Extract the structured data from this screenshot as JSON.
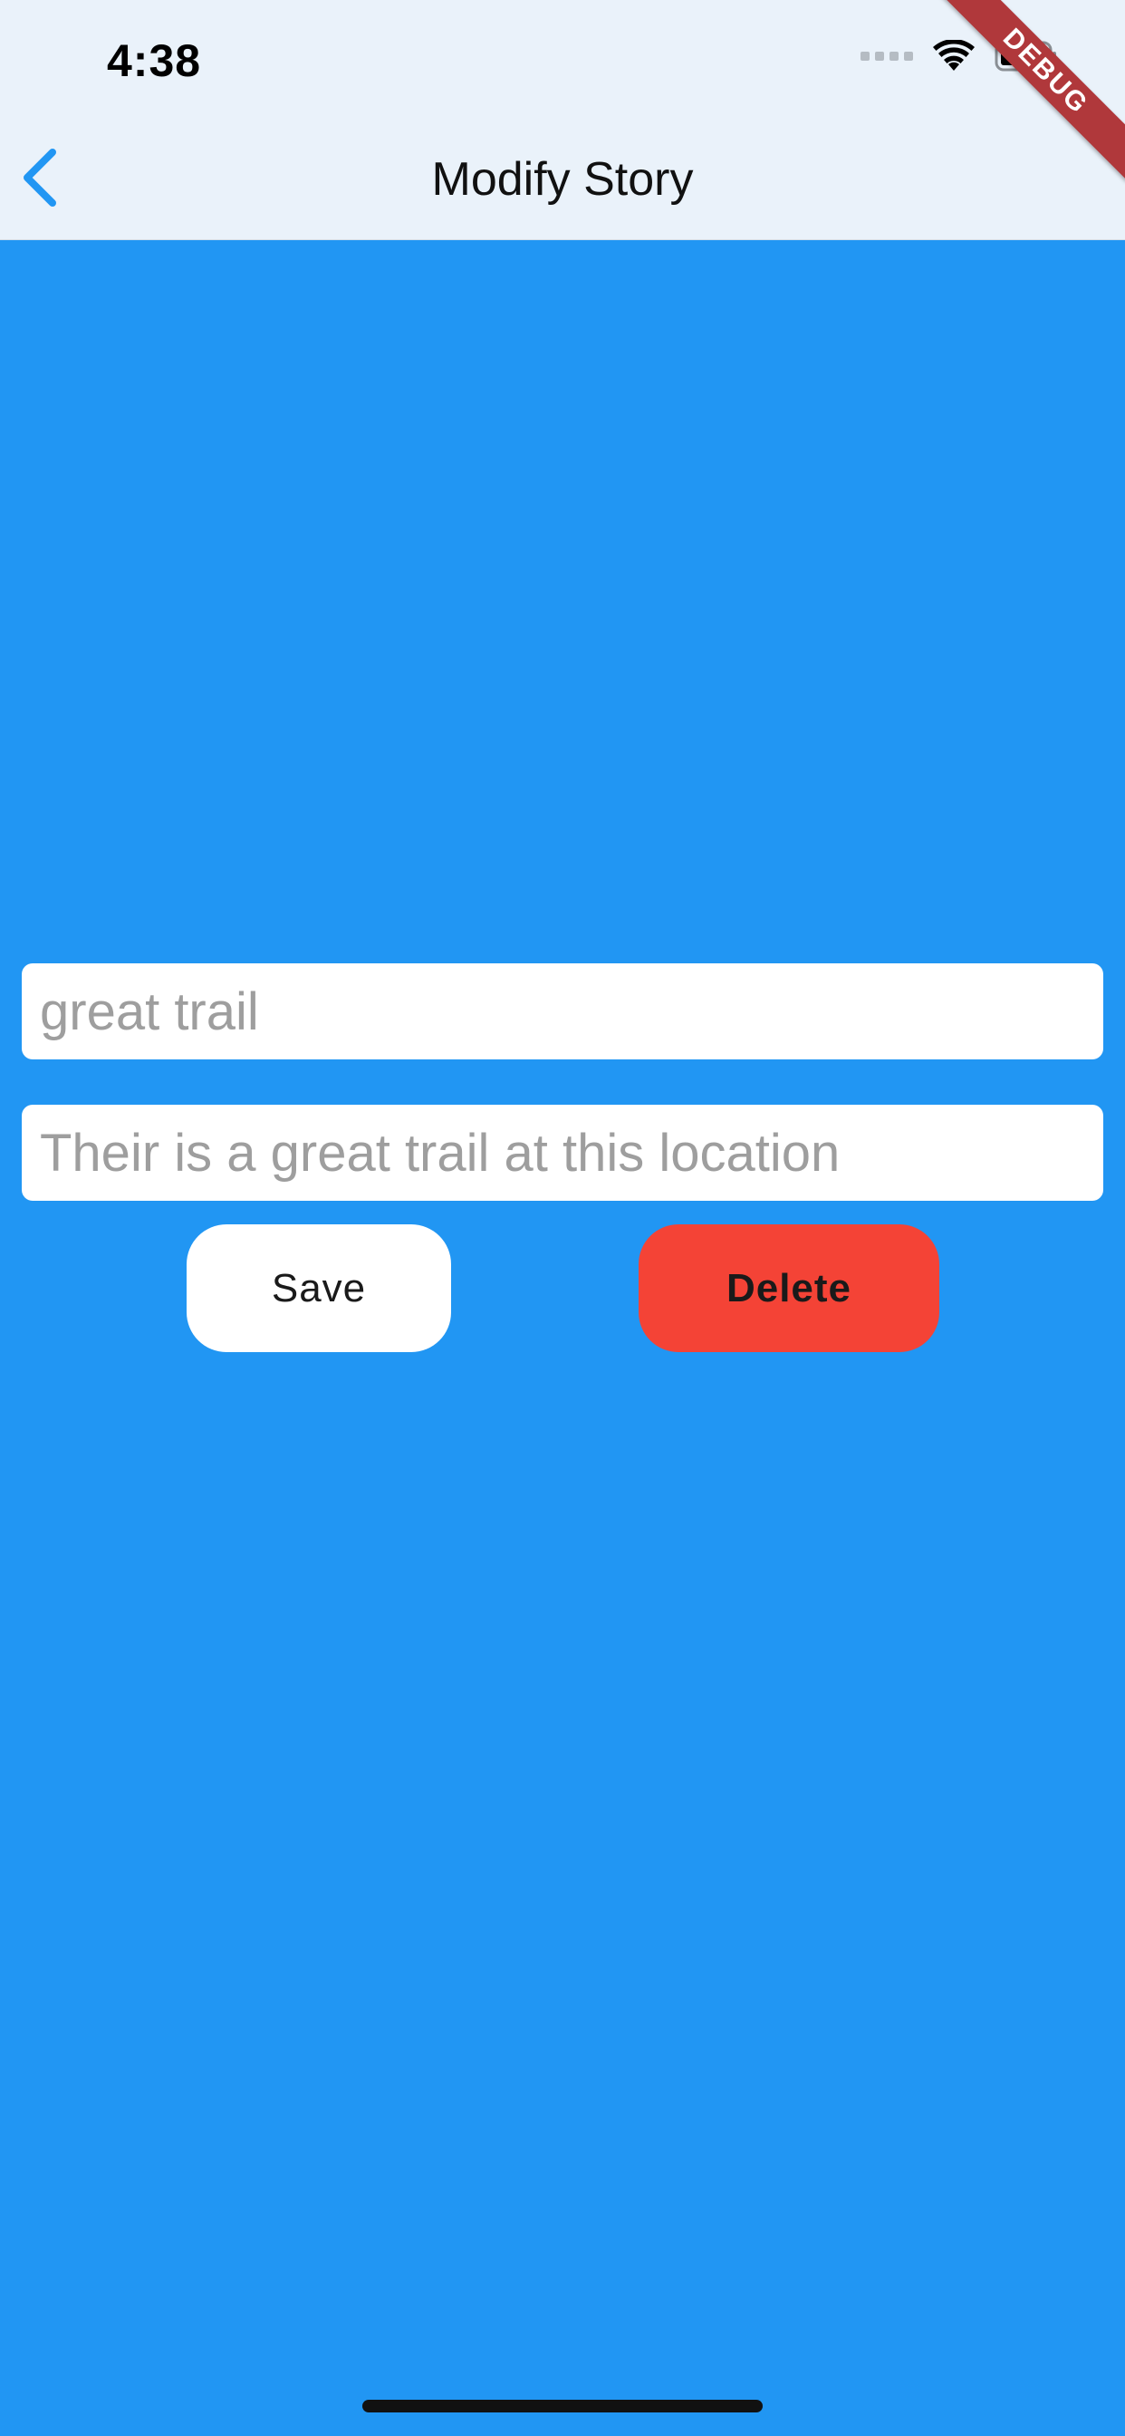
{
  "status_bar": {
    "time": "4:38"
  },
  "debug_banner": "DEBUG",
  "nav": {
    "title": "Modify Story",
    "back_icon": "chevron-left-icon"
  },
  "form": {
    "title_placeholder": "great trail",
    "body_placeholder": "Their is a great trail at this location",
    "save_label": "Save",
    "delete_label": "Delete"
  },
  "colors": {
    "background": "#2196f3",
    "appbar": "#eaf2fa",
    "accent": "#2196f3",
    "delete": "#f44336",
    "debug_banner": "#b0383b"
  }
}
